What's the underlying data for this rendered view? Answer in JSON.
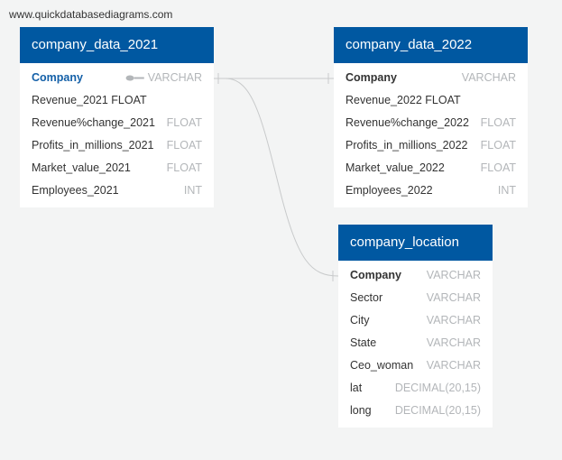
{
  "site": "www.quickdatabasediagrams.com",
  "colors": {
    "header": "#0058a1",
    "background": "#f3f4f4",
    "primary_key": "#1460a8"
  },
  "tables": [
    {
      "name": "company_data_2021",
      "columns": [
        {
          "name": "Company",
          "type": "VARCHAR",
          "pk": true,
          "icon": "key-icon"
        },
        {
          "name": "Revenue_2021 FLOAT",
          "type": ""
        },
        {
          "name": "Revenue%change_2021",
          "type": "FLOAT"
        },
        {
          "name": "Profits_in_millions_2021",
          "type": "FLOAT"
        },
        {
          "name": "Market_value_2021",
          "type": "FLOAT"
        },
        {
          "name": "Employees_2021",
          "type": "INT"
        }
      ]
    },
    {
      "name": "company_data_2022",
      "columns": [
        {
          "name": "Company",
          "type": "VARCHAR"
        },
        {
          "name": "Revenue_2022 FLOAT",
          "type": ""
        },
        {
          "name": "Revenue%change_2022",
          "type": "FLOAT"
        },
        {
          "name": "Profits_in_millions_2022",
          "type": "FLOAT"
        },
        {
          "name": "Market_value_2022",
          "type": "FLOAT"
        },
        {
          "name": "Employees_2022",
          "type": "INT"
        }
      ]
    },
    {
      "name": "company_location",
      "columns": [
        {
          "name": "Company",
          "type": "VARCHAR"
        },
        {
          "name": "Sector",
          "type": "VARCHAR"
        },
        {
          "name": "City",
          "type": "VARCHAR"
        },
        {
          "name": "State",
          "type": "VARCHAR"
        },
        {
          "name": "Ceo_woman",
          "type": "VARCHAR"
        },
        {
          "name": "lat",
          "type": "DECIMAL(20,15)"
        },
        {
          "name": "long",
          "type": "DECIMAL(20,15)"
        }
      ]
    }
  ]
}
